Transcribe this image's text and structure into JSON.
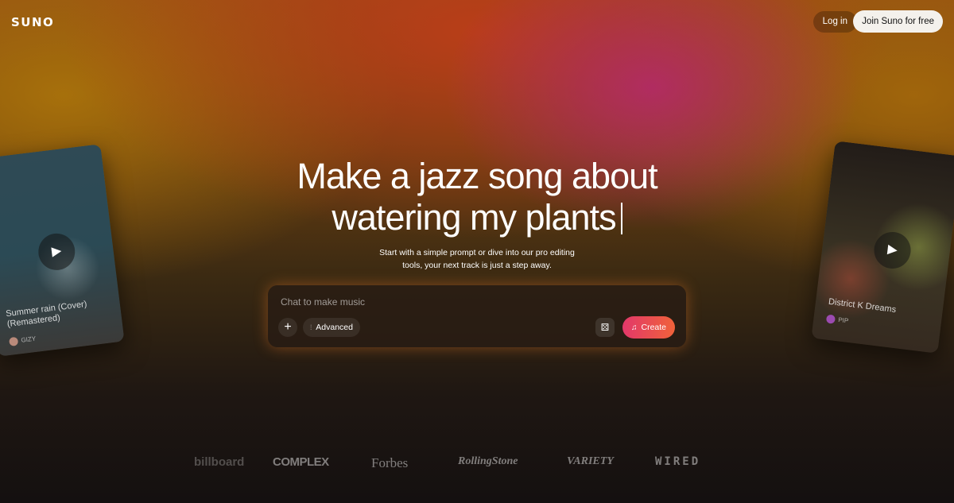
{
  "brand": {
    "logo": "SUNO"
  },
  "header": {
    "login_label": "Log in",
    "join_label": "Join Suno for free"
  },
  "hero": {
    "headline_line1": "Make a jazz song about",
    "headline_line2": "watering my plants",
    "subtext_line1": "Start with a simple prompt or dive into our pro editing",
    "subtext_line2": "tools, your next track is just a step away."
  },
  "composer": {
    "placeholder": "Chat to make music",
    "add_icon": "plus-icon",
    "advanced_label": "Advanced",
    "advanced_icon": "sliders-icon",
    "random_icon": "dice-icon",
    "create_label": "Create",
    "create_icon": "music-note-icon",
    "create_gradient": [
      "#e2386a",
      "#f0623a"
    ]
  },
  "cards": [
    {
      "title": "Summer rain (Cover) (Remastered)",
      "artist": "GIZY"
    },
    {
      "title": "District K Dreams",
      "artist": "PIP"
    }
  ],
  "press_logos": [
    "billboard",
    "COMPLEX",
    "Forbes",
    "RollingStone",
    "VARIETY",
    "WIRED"
  ]
}
